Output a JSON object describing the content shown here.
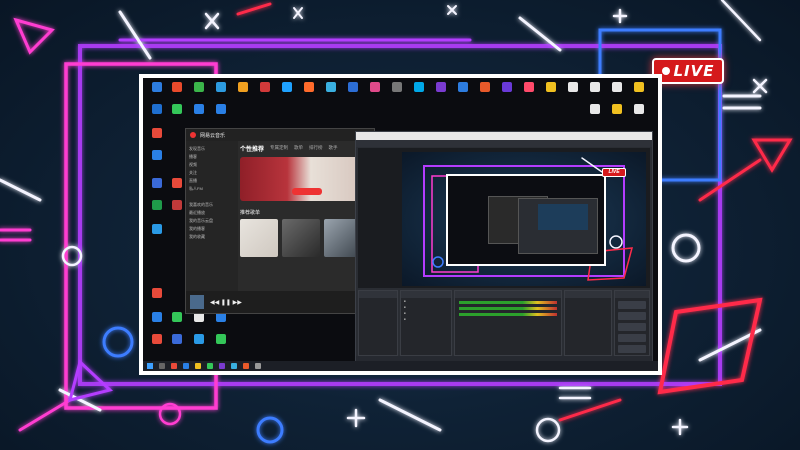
{
  "live_badge": {
    "label": "LIVE"
  },
  "music_app": {
    "title": "网易云音乐",
    "tabs": [
      "个性推荐",
      "专属定制",
      "歌单",
      "排行榜",
      "歌手"
    ],
    "section_title": "推荐歌单",
    "sidebar_items": [
      "发现音乐",
      "播客",
      "视频",
      "关注",
      "直播",
      "私人FM",
      "",
      "我喜欢的音乐",
      "最近播放",
      "我的音乐云盘",
      "我的播客",
      "我的收藏"
    ]
  },
  "obs": {
    "mini_live_label": "LIVE"
  },
  "colors": {
    "live_red": "#d5191c",
    "neon_pink": "#ff3dd1",
    "neon_blue": "#3d7dff",
    "neon_red": "#ff2b4a",
    "neon_white": "#f4f4ff"
  }
}
